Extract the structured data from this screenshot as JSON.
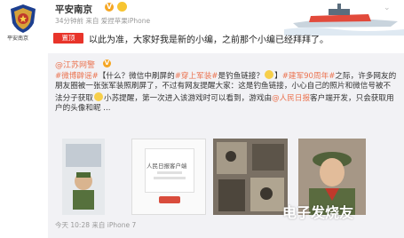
{
  "header": {
    "account_name": "平安南京",
    "meta": "34分钟前 来自 爱捏苹果iPhone",
    "pinned_label": "置顶",
    "post_text": "以此为准，大家好我是新的小编，之前那个小编已经拜拜了。",
    "logo_caption": "平安南京"
  },
  "repost": {
    "author": "@江苏网警",
    "body_parts": [
      {
        "text": "#微博辟谣#",
        "tag": true
      },
      {
        "text": "【什么？微信中刷屏的",
        "tag": false
      },
      {
        "text": "#穿上军装#",
        "tag": true
      },
      {
        "text": "是钓鱼链接？",
        "tag": false
      },
      {
        "text": "",
        "emoji": true
      },
      {
        "text": "】",
        "tag": false
      },
      {
        "text": "#建军90周年#",
        "tag": true
      },
      {
        "text": "之际，许多网友的朋友圈被一张张军装照刷屏了，不过有网友提醒大家：这是钓鱼链接，小心自己的照片和微信号被不法分子获取",
        "tag": false
      },
      {
        "text": "",
        "emoji": true
      },
      {
        "text": "小苏提醒，第一次进入该游戏时可以看到，游戏由",
        "tag": false
      },
      {
        "text": "@人民日报",
        "tag": true
      },
      {
        "text": "客户端开发，只会获取用户的头像和昵 ...",
        "tag": false
      }
    ],
    "image2_title": "人民日报客户端",
    "device": "今天 10:28 来自 iPhone 7"
  },
  "watermark": "电子发烧友",
  "icons": [
    "police-badge-icon",
    "verified-icon",
    "sun-icon",
    "ship-banner",
    "fold-icon"
  ]
}
